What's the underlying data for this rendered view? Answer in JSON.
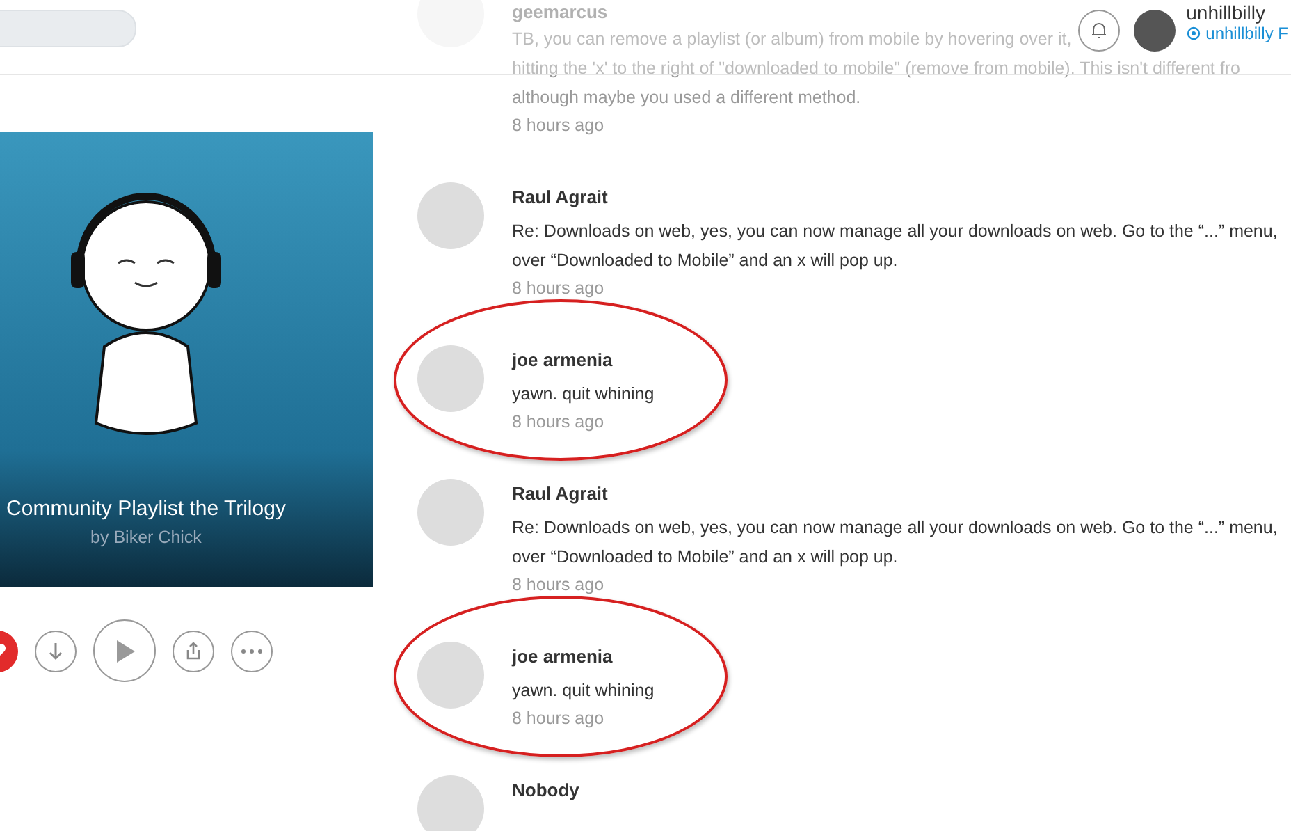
{
  "header": {
    "user": {
      "name": "unhillbilly",
      "link": "unhillbilly F"
    }
  },
  "playlist": {
    "title": "Community Playlist the Trilogy",
    "owner": "by Biker Chick",
    "liked": true
  },
  "comments": [
    {
      "author": "geemarcus",
      "lines": [
        "TB, you can remove a playlist (or album) from mobile by hovering over it,",
        "hitting the 'x' to the right of \"downloaded to mobile\" (remove from mobile). This isn't different fro",
        "although maybe you used a different method."
      ],
      "time": "8 hours ago",
      "highlighted": false
    },
    {
      "author": "Raul Agrait",
      "lines": [
        "Re: Downloads on web, yes, you can now manage all your downloads on web. Go to the “...” menu,",
        "over “Downloaded to Mobile” and an x will pop up."
      ],
      "time": "8 hours ago",
      "highlighted": false
    },
    {
      "author": "joe armenia",
      "lines": [
        "yawn. quit whining"
      ],
      "time": "8 hours ago",
      "highlighted": true
    },
    {
      "author": "Raul Agrait",
      "lines": [
        "Re: Downloads on web, yes, you can now manage all your downloads on web. Go to the “...” menu,",
        "over “Downloaded to Mobile” and an x will pop up."
      ],
      "time": "8 hours ago",
      "highlighted": false
    },
    {
      "author": "joe armenia",
      "lines": [
        "yawn. quit whining"
      ],
      "time": "8 hours ago",
      "highlighted": true
    },
    {
      "author": "Nobody",
      "highlighted": false
    }
  ]
}
